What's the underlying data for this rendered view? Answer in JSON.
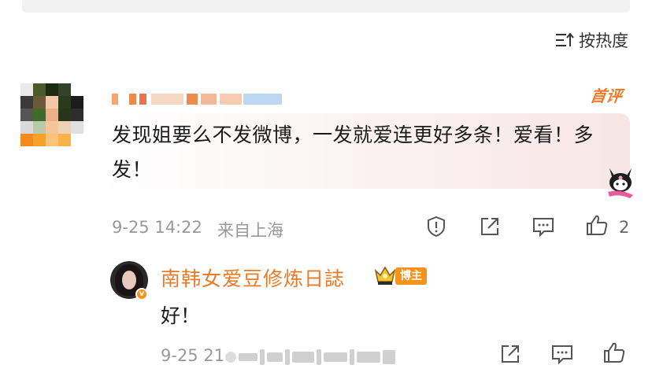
{
  "sort": {
    "label": "按热度"
  },
  "comment": {
    "badge": "首评",
    "text": "发现姐要么不发微博，一发就爱连更好多条！爱看！多发！",
    "time": "9-25 14:22",
    "location": "来自上海",
    "like_count": "2"
  },
  "reply": {
    "author": "南韩女爱豆修炼日誌",
    "author_badge": "博主",
    "text": "好！",
    "time": "9-25 21"
  },
  "colors": {
    "accent": "#eb7a26",
    "badge_bg": "#f7931a",
    "meta_text": "#999999"
  }
}
